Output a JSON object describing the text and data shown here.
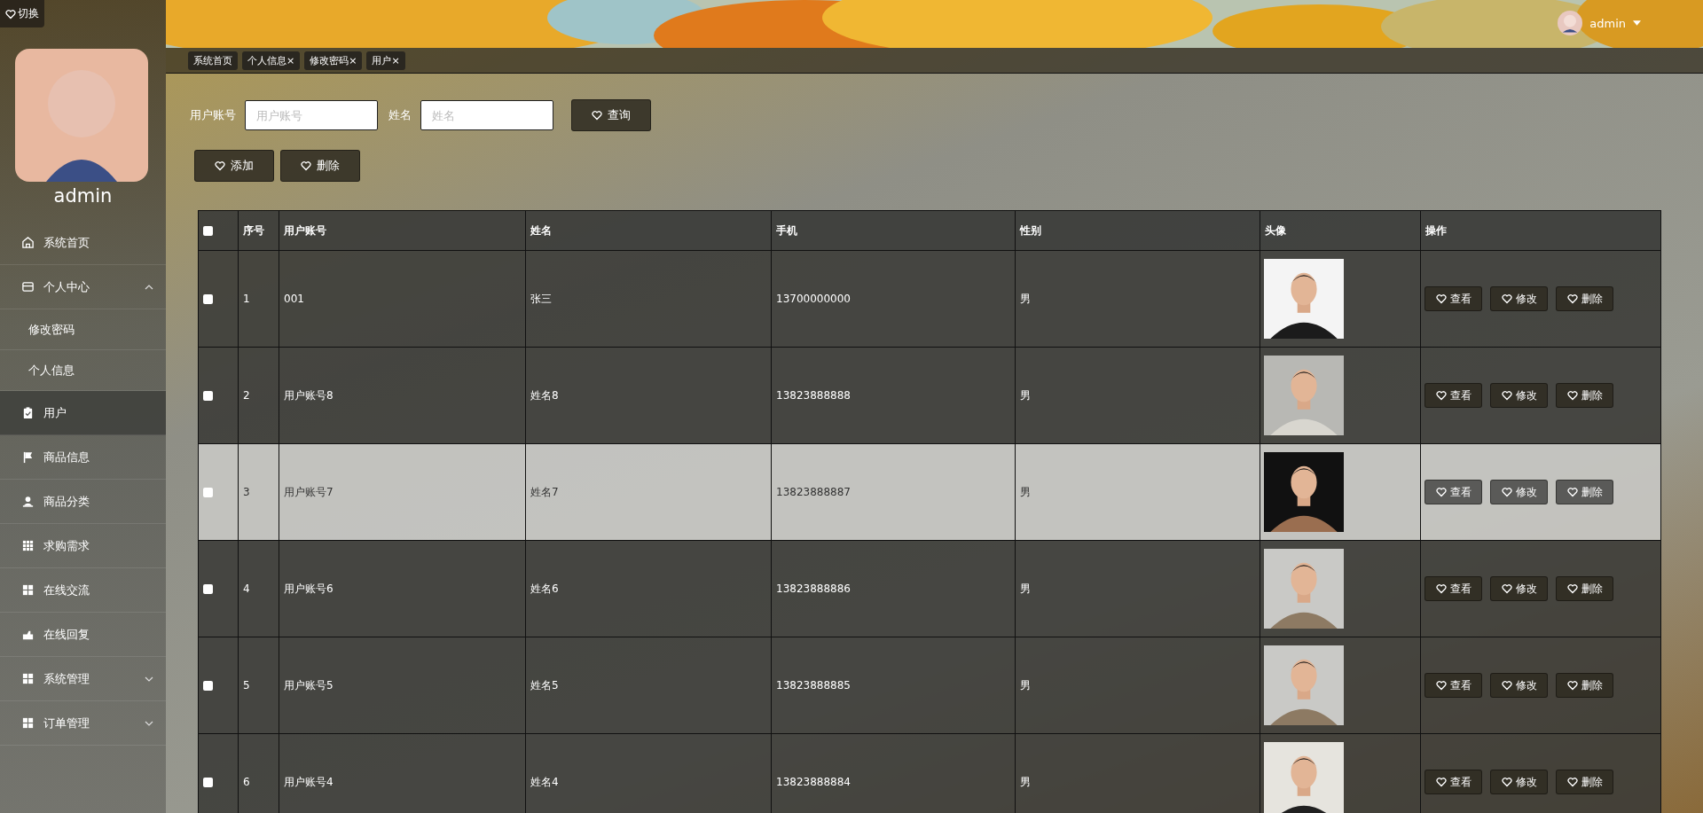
{
  "sidebar": {
    "switch_button": "切换",
    "user_name": "admin",
    "items": [
      {
        "kind": "link",
        "label": "系统首页",
        "selected": false
      },
      {
        "kind": "group",
        "label": "个人中心",
        "selected": false,
        "expanded": true,
        "children": [
          {
            "label": "修改密码",
            "selected": false
          },
          {
            "label": "个人信息",
            "selected": false
          }
        ]
      },
      {
        "kind": "link",
        "label": "用户",
        "selected": true
      },
      {
        "kind": "link",
        "label": "商品信息",
        "selected": false
      },
      {
        "kind": "link",
        "label": "商品分类",
        "selected": false
      },
      {
        "kind": "link",
        "label": "求购需求",
        "selected": false
      },
      {
        "kind": "link",
        "label": "在线交流",
        "selected": false
      },
      {
        "kind": "link",
        "label": "在线回复",
        "selected": false
      },
      {
        "kind": "group",
        "label": "系统管理",
        "selected": false,
        "expanded": false
      },
      {
        "kind": "group",
        "label": "订单管理",
        "selected": false,
        "expanded": false
      }
    ]
  },
  "header": {
    "user_name": "admin"
  },
  "tabs": [
    {
      "label": "系统首页"
    },
    {
      "label": "个人信息",
      "close_mark": "×"
    },
    {
      "label": "修改密码",
      "close_mark": "×"
    },
    {
      "label": "用户",
      "close_mark": "×"
    }
  ],
  "search": {
    "fields": [
      {
        "label": "用户账号",
        "placeholder": "用户账号"
      },
      {
        "label": "姓名",
        "placeholder": "姓名"
      }
    ],
    "button": "查询"
  },
  "actions": [
    "添加",
    "删除"
  ],
  "table": {
    "header_checked": false,
    "columns": [
      "序号",
      "用户账号",
      "姓名",
      "手机",
      "性别",
      "头像",
      "操作"
    ],
    "rows": [
      {
        "index": "1",
        "account": "001",
        "name": "张三",
        "phone": "13700000000",
        "gender": "男",
        "checked": false,
        "highlighted": false,
        "actions": [
          "查看",
          "修改",
          "删除"
        ]
      },
      {
        "index": "2",
        "account": "用户账号8",
        "name": "姓名8",
        "phone": "13823888888",
        "gender": "男",
        "checked": false,
        "highlighted": false,
        "actions": [
          "查看",
          "修改",
          "删除"
        ]
      },
      {
        "index": "3",
        "account": "用户账号7",
        "name": "姓名7",
        "phone": "13823888887",
        "gender": "男",
        "checked": false,
        "highlighted": true,
        "actions": [
          "查看",
          "修改",
          "删除"
        ]
      },
      {
        "index": "4",
        "account": "用户账号6",
        "name": "姓名6",
        "phone": "13823888886",
        "gender": "男",
        "checked": false,
        "highlighted": false,
        "actions": [
          "查看",
          "修改",
          "删除"
        ]
      },
      {
        "index": "5",
        "account": "用户账号5",
        "name": "姓名5",
        "phone": "13823888885",
        "gender": "男",
        "checked": false,
        "highlighted": false,
        "actions": [
          "查看",
          "修改",
          "删除"
        ]
      },
      {
        "index": "6",
        "account": "用户账号4",
        "name": "姓名4",
        "phone": "13823888884",
        "gender": "男",
        "checked": false,
        "highlighted": false,
        "actions": [
          "查看",
          "修改",
          "删除"
        ]
      }
    ]
  }
}
